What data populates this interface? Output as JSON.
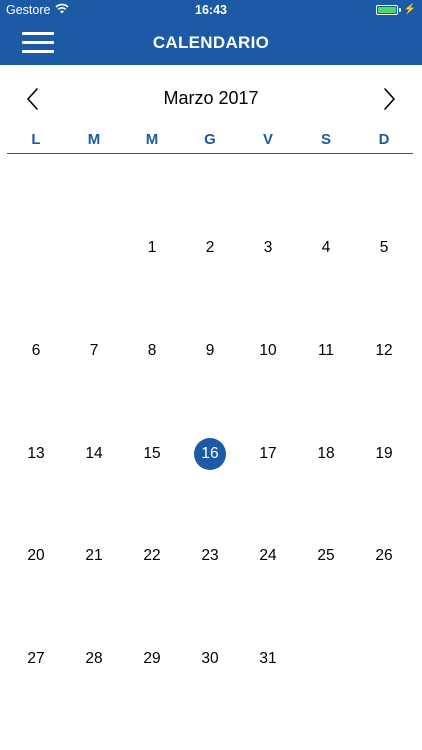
{
  "status": {
    "carrier": "Gestore",
    "time": "16:43",
    "battery_color": "#4cd964"
  },
  "nav": {
    "title": "CALENDARIO",
    "menu_icon": "hamburger-menu-icon"
  },
  "calendar": {
    "month_label": "Marzo 2017",
    "weekdays": [
      "L",
      "M",
      "M",
      "G",
      "V",
      "S",
      "D"
    ],
    "selected_day": "16",
    "weeks": [
      [
        "",
        "",
        "1",
        "2",
        "3",
        "4",
        "5"
      ],
      [
        "6",
        "7",
        "8",
        "9",
        "10",
        "11",
        "12"
      ],
      [
        "13",
        "14",
        "15",
        "16",
        "17",
        "18",
        "19"
      ],
      [
        "20",
        "21",
        "22",
        "23",
        "24",
        "25",
        "26"
      ],
      [
        "27",
        "28",
        "29",
        "30",
        "31",
        "",
        ""
      ]
    ]
  },
  "colors": {
    "accent": "#1c5aa6",
    "text": "#000000",
    "background": "#ffffff"
  }
}
